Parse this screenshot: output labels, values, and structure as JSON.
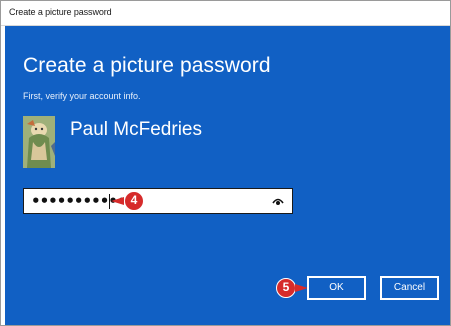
{
  "window": {
    "title": "Create a picture password"
  },
  "main": {
    "heading": "Create a picture password",
    "subheading": "First, verify your account info.",
    "user_name": "Paul McFedries",
    "password": {
      "masked_value": "•••••••••••••",
      "reveal_icon": "eye-icon"
    }
  },
  "callouts": {
    "step4": "4",
    "step5": "5"
  },
  "buttons": {
    "ok_label": "OK",
    "cancel_label": "Cancel"
  },
  "colors": {
    "dialog_background": "#1160c4",
    "callout": "#d62b2b"
  }
}
